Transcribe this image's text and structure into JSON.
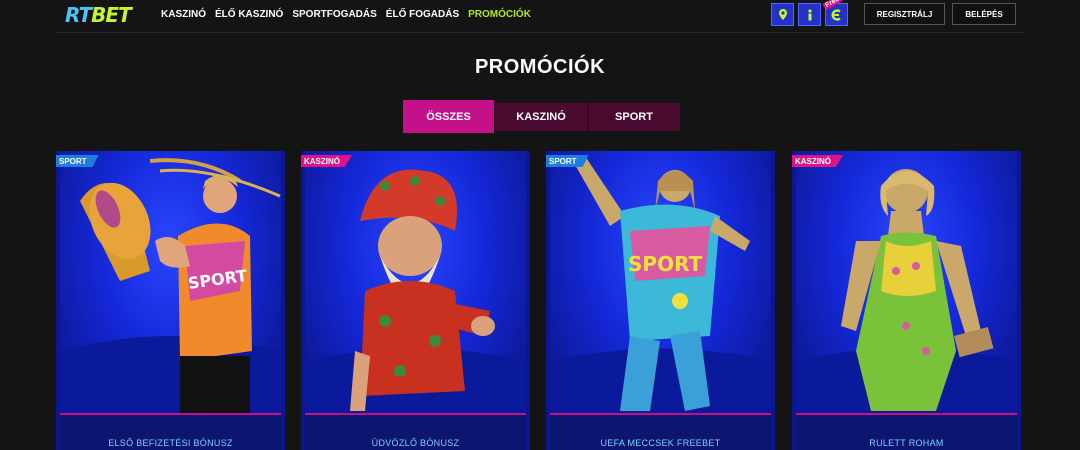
{
  "header": {
    "logo": {
      "part1": "RT",
      "part2": "BET"
    },
    "nav": [
      {
        "label": "KASZINÓ",
        "active": false
      },
      {
        "label": "ÉLŐ KASZINÓ",
        "active": false
      },
      {
        "label": "SPORTFOGADÁS",
        "active": false
      },
      {
        "label": "ÉLŐ FOGADÁS",
        "active": false
      },
      {
        "label": "PROMÓCIÓK",
        "active": true
      }
    ],
    "icons": [
      "location-pin-icon",
      "info-icon",
      "free-coin-icon"
    ],
    "free_badge": "Free",
    "register_label": "REGISZTRÁLJ",
    "login_label": "BELÉPÉS"
  },
  "page": {
    "title": "PROMÓCIÓK",
    "tabs": [
      {
        "label": "ÖSSZES",
        "active": true
      },
      {
        "label": "KASZINÓ",
        "active": false
      },
      {
        "label": "SPORT",
        "active": false
      }
    ]
  },
  "cards": [
    {
      "tag": "SPORT",
      "tag_type": "sport",
      "title": "ELSŐ BEFIZETÉSI BÓNUSZ",
      "art": "footballer-with-trophy"
    },
    {
      "tag": "KASZINÓ",
      "tag_type": "kaszino",
      "title": "ÜDVÖZLŐ BÓNUSZ",
      "art": "bearded-gnome"
    },
    {
      "tag": "SPORT",
      "tag_type": "sport",
      "title": "UEFA MECCSEK FREEBET",
      "art": "sport-statue"
    },
    {
      "tag": "KASZINÓ",
      "tag_type": "kaszino",
      "title": "RULETT ROHAM",
      "art": "woman-in-dress-statue"
    }
  ],
  "colors": {
    "background": "#141414",
    "accent_pink": "#c4118a",
    "accent_green": "#b5e61d",
    "card_blue": "#1428d8",
    "sport_tag": "#1e7be0",
    "kaszino_tag": "#e0128a"
  }
}
